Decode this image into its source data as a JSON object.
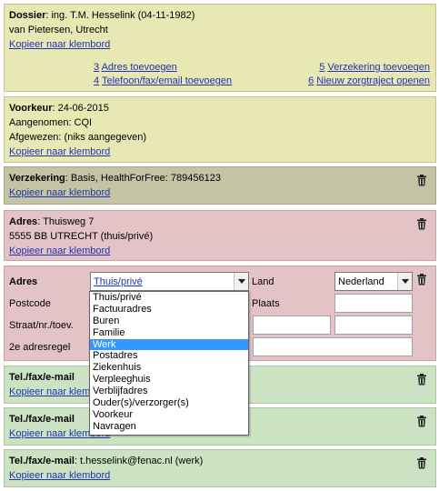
{
  "dossier": {
    "label": "Dossier",
    "name": ": ing. T.M. Hesselink (04-11-1982)",
    "address": "van Pietersen, Utrecht",
    "copy": "Kopieer naar klembord",
    "actions": [
      {
        "num": "3",
        "label": "Adres toevoegen"
      },
      {
        "num": "4",
        "label": "Telefoon/fax/email toevoegen"
      },
      {
        "num": "5",
        "label": "Verzekering toevoegen"
      },
      {
        "num": "6",
        "label": "Nieuw zorgtraject openen"
      }
    ]
  },
  "voorkeur": {
    "label": "Voorkeur",
    "date": ": 24-06-2015",
    "aangenomen": "Aangenomen: CQI",
    "afgewezen": "Afgewezen: (niks aangegeven)",
    "copy": "Kopieer naar klembord"
  },
  "verzekering": {
    "label": "Verzekering",
    "value": ": Basis,  HealthForFree: 789456123",
    "copy": "Kopieer naar klembord"
  },
  "adres": {
    "label": "Adres",
    "street": ": Thuisweg 7",
    "city": "5555 BB  UTRECHT (thuis/privé)",
    "copy": "Kopieer naar klembord"
  },
  "form": {
    "adres_label": "Adres",
    "type_value": "Thuis/privé",
    "land_label": "Land",
    "land_value": "Nederland",
    "postcode_label": "Postcode",
    "plaats_label": "Plaats",
    "straat_label": "Straat/nr./toev.",
    "adresregel_label": "2e adresregel"
  },
  "dropdown": {
    "options": [
      "Thuis/privé",
      "Factuuradres",
      "Buren",
      "Familie",
      "Werk",
      "Postadres",
      "Ziekenhuis",
      "Verpleeghuis",
      "Verblijfadres",
      "Ouder(s)/verzorger(s)",
      "Voorkeur",
      "Navragen"
    ],
    "selected": "Werk"
  },
  "tel1": {
    "label": "Tel./fax/e-mail",
    "copy": "Kopieer naar klembord"
  },
  "tel2": {
    "label": "Tel./fax/e-mail",
    "copy": "Kopieer naar klembord"
  },
  "tel3": {
    "label": "Tel./fax/e-mail",
    "value": ": t.hesselink@fenac.nl (werk)",
    "copy": "Kopieer naar klembord"
  },
  "icons": [
    "trash-icon",
    "chevron-down-icon"
  ],
  "colors": {
    "yellow": "#e8e8b4",
    "olive": "#c4c4a4",
    "pink": "#e3c3c6",
    "green": "#cce3c3",
    "link": "#1f33b0",
    "highlight": "#3399ff"
  }
}
